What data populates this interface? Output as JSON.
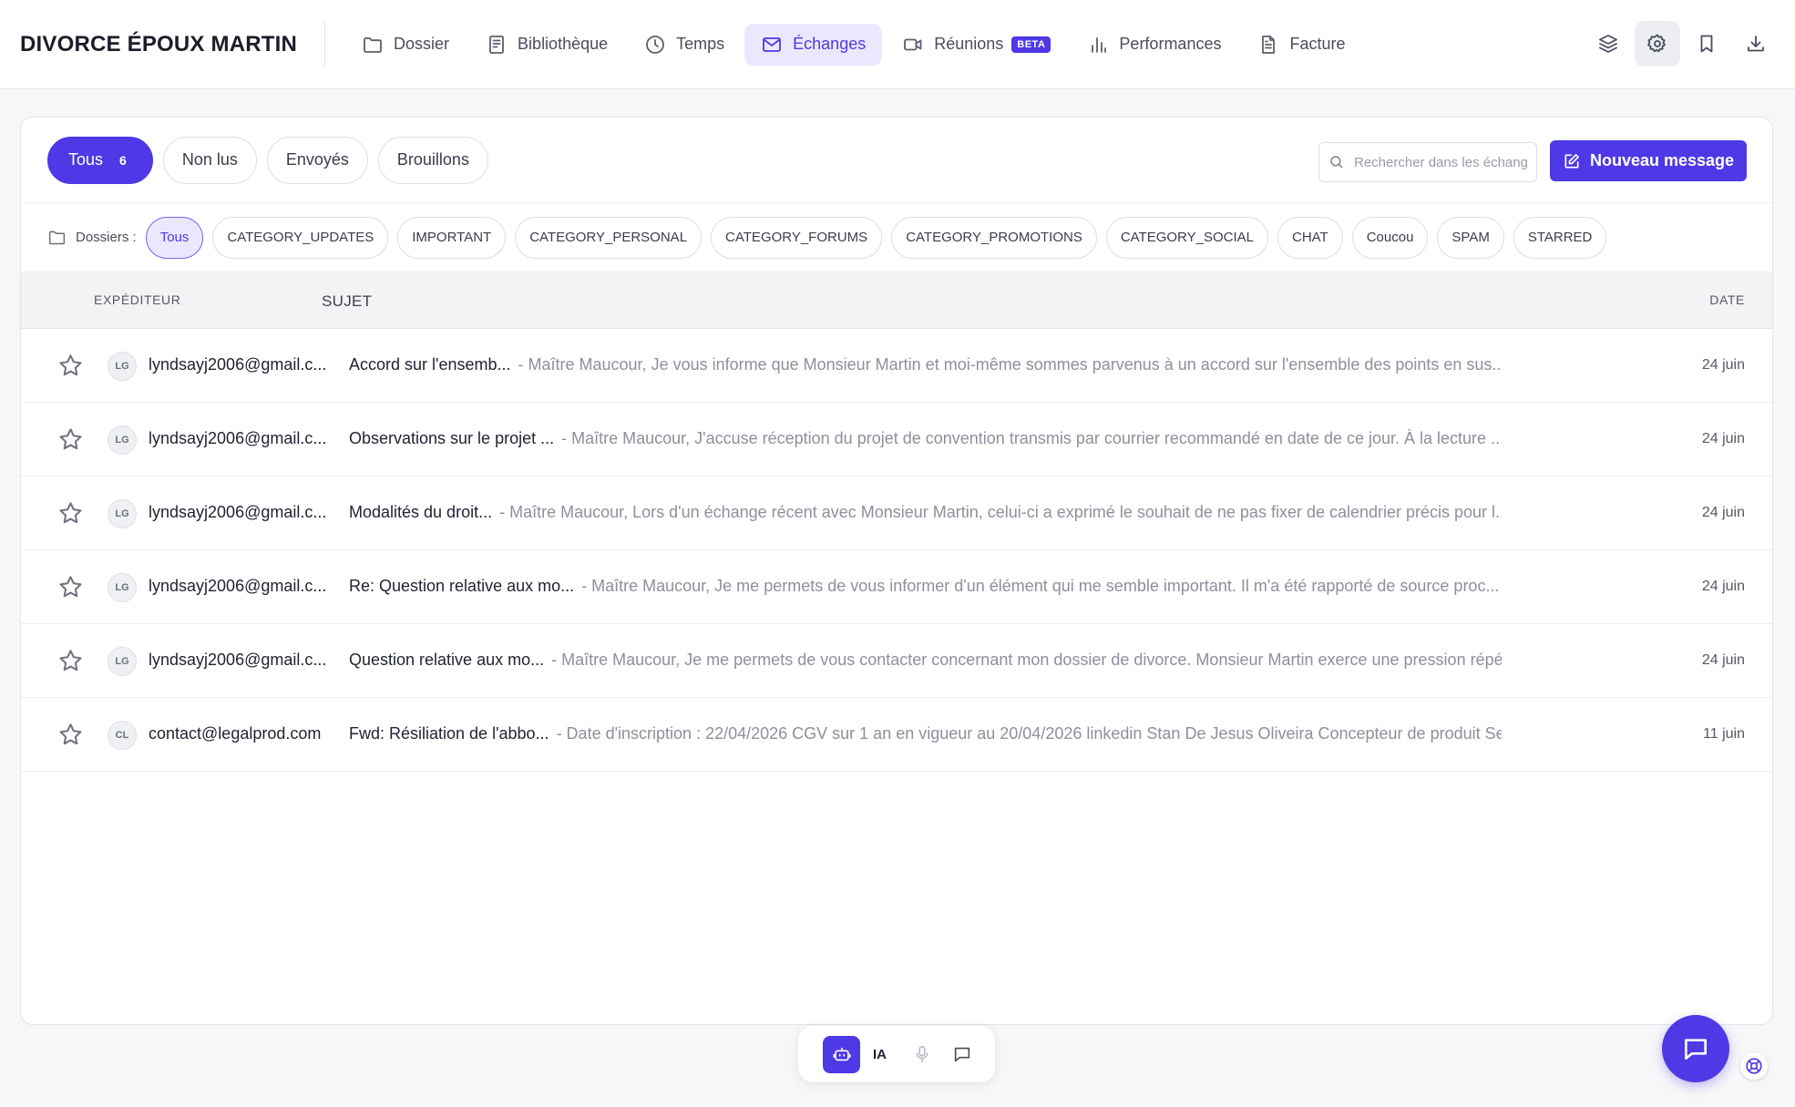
{
  "header": {
    "case_title": "DIVORCE ÉPOUX MARTIN",
    "nav": [
      {
        "label": "Dossier",
        "icon": "folder-icon"
      },
      {
        "label": "Bibliothèque",
        "icon": "book-icon"
      },
      {
        "label": "Temps",
        "icon": "clock-icon"
      },
      {
        "label": "Échanges",
        "icon": "mail-icon",
        "active": true
      },
      {
        "label": "Réunions",
        "icon": "video-icon",
        "badge": "BETA"
      },
      {
        "label": "Performances",
        "icon": "bar-chart-icon"
      },
      {
        "label": "Facture",
        "icon": "invoice-icon"
      }
    ],
    "actions": [
      "layers-icon",
      "settings-icon",
      "bookmark-icon",
      "download-icon"
    ]
  },
  "filters": {
    "tabs": [
      {
        "label": "Tous",
        "count": "6",
        "active": true
      },
      {
        "label": "Non lus"
      },
      {
        "label": "Envoyés"
      },
      {
        "label": "Brouillons"
      }
    ],
    "search_placeholder": "Rechercher dans les échanges",
    "new_message_label": "Nouveau message"
  },
  "folders": {
    "label": "Dossiers :",
    "items": [
      {
        "label": "Tous",
        "active": true
      },
      {
        "label": "CATEGORY_UPDATES"
      },
      {
        "label": "IMPORTANT"
      },
      {
        "label": "CATEGORY_PERSONAL"
      },
      {
        "label": "CATEGORY_FORUMS"
      },
      {
        "label": "CATEGORY_PROMOTIONS"
      },
      {
        "label": "CATEGORY_SOCIAL"
      },
      {
        "label": "CHAT"
      },
      {
        "label": "Coucou"
      },
      {
        "label": "SPAM"
      },
      {
        "label": "STARRED"
      }
    ]
  },
  "table": {
    "columns": {
      "sender": "EXPÉDITEUR",
      "subject": "SUJET",
      "date": "DATE"
    },
    "rows": [
      {
        "initials": "LG",
        "sender": "lyndsayj2006@gmail.c...",
        "subject": "Accord sur l'ensemb...",
        "preview": "- Maître Maucour, Je vous informe que Monsieur Martin et moi-même sommes parvenus à un accord sur l'ensemble des points en sus...",
        "date": "24 juin"
      },
      {
        "initials": "LG",
        "sender": "lyndsayj2006@gmail.c...",
        "subject": "Observations sur le projet ...",
        "preview": "- Maître Maucour, J'accuse réception du projet de convention transmis par courrier recommandé en date de ce jour. À la lecture ...",
        "date": "24 juin"
      },
      {
        "initials": "LG",
        "sender": "lyndsayj2006@gmail.c...",
        "subject": "Modalités du droit...",
        "preview": "- Maître Maucour, Lors d'un échange récent avec Monsieur Martin, celui-ci a exprimé le souhait de ne pas fixer de calendrier précis pour l...",
        "date": "24 juin"
      },
      {
        "initials": "LG",
        "sender": "lyndsayj2006@gmail.c...",
        "subject": "Re: Question relative aux mo...",
        "preview": "- Maître Maucour, Je me permets de vous informer d'un élément qui me semble important. Il m'a été rapporté de source proc...",
        "date": "24 juin"
      },
      {
        "initials": "LG",
        "sender": "lyndsayj2006@gmail.c...",
        "subject": "Question relative aux mo...",
        "preview": "- Maître Maucour, Je me permets de vous contacter concernant mon dossier de divorce. Monsieur Martin exerce une pression répé...",
        "date": "24 juin"
      },
      {
        "initials": "CL",
        "sender": "contact@legalprod.com",
        "subject": "Fwd: Résiliation de l'abbo...",
        "preview": "- Date d'inscription : 22/04/2026 CGV sur 1 an en vigueur au 20/04/2026 linkedin Stan De Jesus Oliveira Concepteur de produit Se...",
        "date": "11 juin"
      }
    ]
  },
  "assistant": {
    "ai_label": "IA"
  },
  "colors": {
    "accent": "#4f38e6",
    "accent_light": "#ebe8fd"
  }
}
